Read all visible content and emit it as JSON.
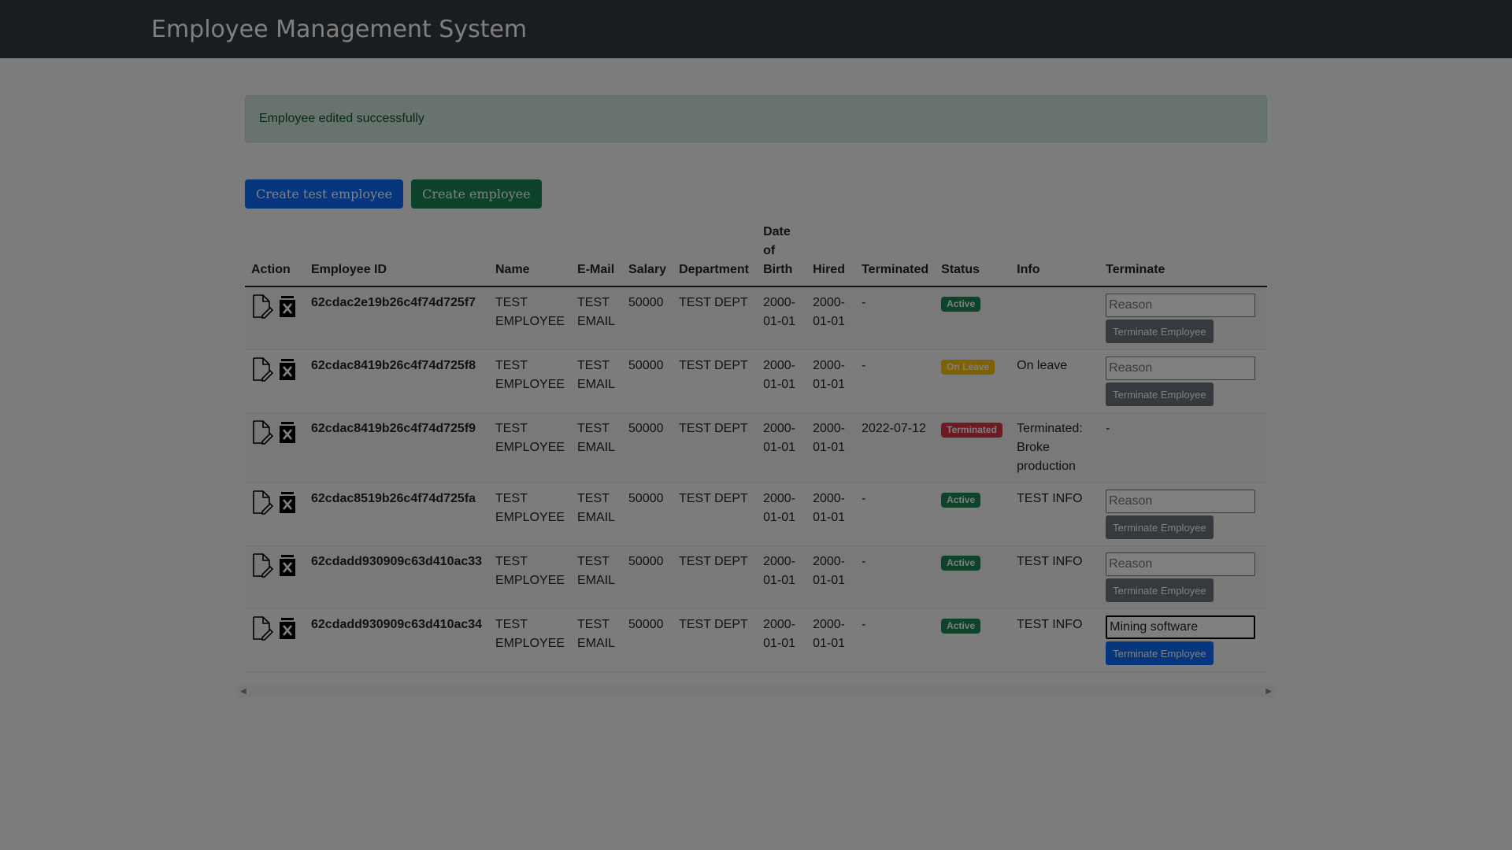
{
  "header": {
    "title": "Employee Management System"
  },
  "alert": {
    "message": "Employee edited successfully"
  },
  "buttons": {
    "create_test": "Create test employee",
    "create": "Create employee"
  },
  "table": {
    "headers": {
      "action": "Action",
      "employee_id": "Employee ID",
      "name": "Name",
      "email": "E-Mail",
      "salary": "Salary",
      "department": "Department",
      "dob_1": "Date",
      "dob_2": "of",
      "dob_3": "Birth",
      "hired": "Hired",
      "terminated": "Terminated",
      "status": "Status",
      "info": "Info",
      "terminate": "Terminate"
    },
    "rows": [
      {
        "id": "62cdac2e19b26c4f74d725f7",
        "name_1": "TEST",
        "name_2": "EMPLOYEE",
        "email_1": "TEST",
        "email_2": "EMAIL",
        "salary": "50000",
        "department": "TEST DEPT",
        "dob_1": "2000-",
        "dob_2": "01-01",
        "hired_1": "2000-",
        "hired_2": "01-01",
        "terminated": "-",
        "status": "Active",
        "info": "",
        "reason_placeholder": "Reason",
        "reason_value": "",
        "terminate_label": "Terminate Employee"
      },
      {
        "id": "62cdac8419b26c4f74d725f8",
        "name_1": "TEST",
        "name_2": "EMPLOYEE",
        "email_1": "TEST",
        "email_2": "EMAIL",
        "salary": "50000",
        "department": "TEST DEPT",
        "dob_1": "2000-",
        "dob_2": "01-01",
        "hired_1": "2000-",
        "hired_2": "01-01",
        "terminated": "-",
        "status": "On Leave",
        "info": "On leave",
        "reason_placeholder": "Reason",
        "reason_value": "",
        "terminate_label": "Terminate Employee"
      },
      {
        "id": "62cdac8419b26c4f74d725f9",
        "name_1": "TEST",
        "name_2": "EMPLOYEE",
        "email_1": "TEST",
        "email_2": "EMAIL",
        "salary": "50000",
        "department": "TEST DEPT",
        "dob_1": "2000-",
        "dob_2": "01-01",
        "hired_1": "2000-",
        "hired_2": "01-01",
        "terminated": "2022-07-12",
        "status": "Terminated",
        "info_1": "Terminated:",
        "info_2": "Broke",
        "info_3": "production",
        "terminate_cell": "-"
      },
      {
        "id": "62cdac8519b26c4f74d725fa",
        "name_1": "TEST",
        "name_2": "EMPLOYEE",
        "email_1": "TEST",
        "email_2": "EMAIL",
        "salary": "50000",
        "department": "TEST DEPT",
        "dob_1": "2000-",
        "dob_2": "01-01",
        "hired_1": "2000-",
        "hired_2": "01-01",
        "terminated": "-",
        "status": "Active",
        "info": "TEST INFO",
        "reason_placeholder": "Reason",
        "reason_value": "",
        "terminate_label": "Terminate Employee"
      },
      {
        "id": "62cdadd930909c63d410ac33",
        "name_1": "TEST",
        "name_2": "EMPLOYEE",
        "email_1": "TEST",
        "email_2": "EMAIL",
        "salary": "50000",
        "department": "TEST DEPT",
        "dob_1": "2000-",
        "dob_2": "01-01",
        "hired_1": "2000-",
        "hired_2": "01-01",
        "terminated": "-",
        "status": "Active",
        "info": "TEST INFO",
        "reason_placeholder": "Reason",
        "reason_value": "",
        "terminate_label": "Terminate Employee"
      },
      {
        "id": "62cdadd930909c63d410ac34",
        "name_1": "TEST",
        "name_2": "EMPLOYEE",
        "email_1": "TEST",
        "email_2": "EMAIL",
        "salary": "50000",
        "department": "TEST DEPT",
        "dob_1": "2000-",
        "dob_2": "01-01",
        "hired_1": "2000-",
        "hired_2": "01-01",
        "terminated": "-",
        "status": "Active",
        "info": "TEST INFO",
        "reason_placeholder": "Reason",
        "reason_value": "Mining software",
        "terminate_label": "Terminate Employee"
      }
    ]
  },
  "icons": {
    "edit": "edit-document-icon",
    "delete": "delete-x-icon",
    "scroll_left": "scroll-left-arrow-icon",
    "scroll_right": "scroll-right-arrow-icon"
  },
  "colors": {
    "navbar": "#343a40",
    "primary": "#0d6efd",
    "success": "#198754",
    "warning": "#ffc107",
    "danger": "#dc3545",
    "secondary": "#6c757d",
    "alert_bg": "#d1e7dd"
  },
  "modal_backdrop": true
}
